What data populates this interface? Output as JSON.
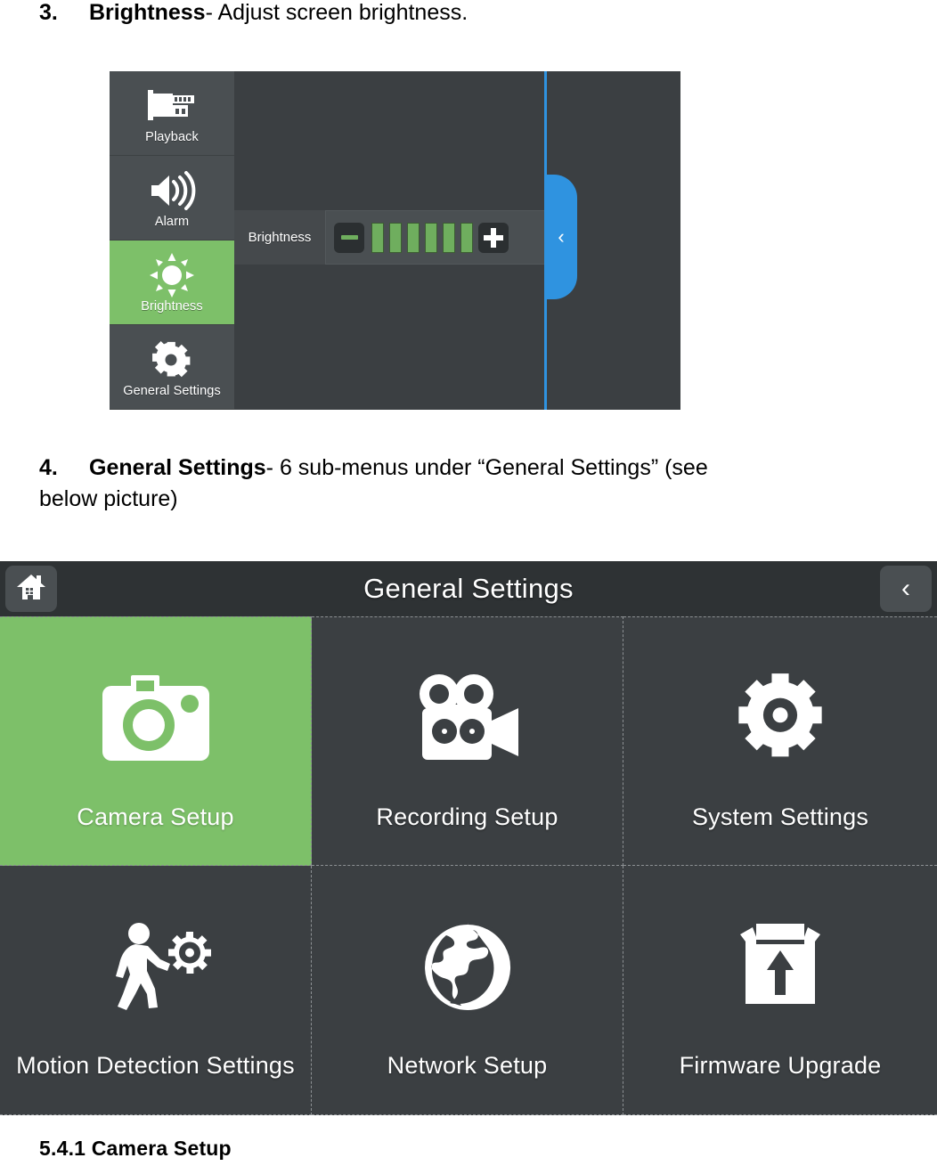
{
  "document": {
    "step3": {
      "number": "3.",
      "term": "Brightness",
      "rest": "- Adjust screen brightness."
    },
    "step4": {
      "number": "4.",
      "term": "General Settings",
      "rest": "- 6 sub-menus under “General Settings”   (see",
      "continuation": "below picture)"
    },
    "section_heading": "5.4.1 Camera Setup"
  },
  "brightness_osd": {
    "sidebar": [
      {
        "label": "Playback",
        "icon": "film-roll-icon",
        "selected": false
      },
      {
        "label": "Alarm",
        "icon": "speaker-wave-icon",
        "selected": false
      },
      {
        "label": "Brightness",
        "icon": "sun-icon",
        "selected": true
      },
      {
        "label": "General Settings",
        "icon": "gear-icon",
        "selected": false
      }
    ],
    "control": {
      "label": "Brightness",
      "decrease_icon": "minus-icon",
      "increase_icon": "plus-icon",
      "level": 6,
      "max_level": 6
    },
    "pull_tab": {
      "icon": "chevron-left-icon",
      "glyph": "‹",
      "color": "#2f93e0"
    },
    "colors": {
      "panel": "#3b3f42",
      "sidebar": "#4a4f52",
      "accent_green": "#7dc069",
      "level_green": "#6fae5e",
      "accent_blue": "#2f93e0"
    }
  },
  "general_settings": {
    "header": {
      "home_icon": "home-icon",
      "title": "General Settings",
      "back_icon": "chevron-left-icon",
      "back_glyph": "‹"
    },
    "tiles": [
      {
        "label": "Camera Setup",
        "icon": "camera-icon",
        "selected": true
      },
      {
        "label": "Recording Setup",
        "icon": "movie-camera-icon",
        "selected": false
      },
      {
        "label": "System Settings",
        "icon": "gear-icon",
        "selected": false
      },
      {
        "label": "Motion Detection Settings",
        "icon": "walking-person-gear-icon",
        "selected": false
      },
      {
        "label": "Network Setup",
        "icon": "globe-icon",
        "selected": false
      },
      {
        "label": "Firmware Upgrade",
        "icon": "box-upload-icon",
        "selected": false
      }
    ],
    "colors": {
      "panel": "#3b3f42",
      "header": "#2e3234",
      "selected_green": "#7dc069",
      "divider": "#8d9194"
    }
  }
}
